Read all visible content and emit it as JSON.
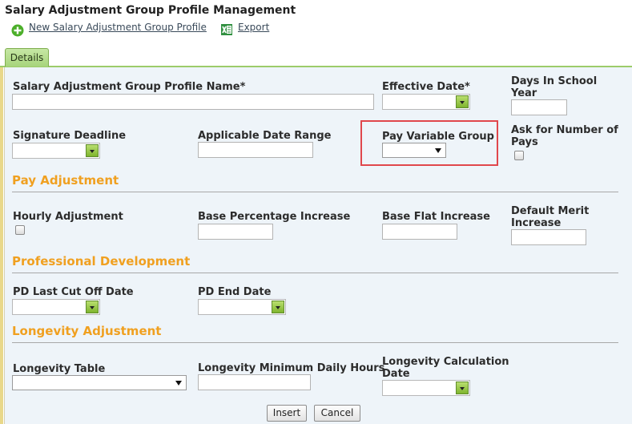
{
  "page": {
    "title": "Salary Adjustment Group Profile Management"
  },
  "toolbar": {
    "new_label": "New Salary Adjustment Group Profile",
    "export_label": "Export",
    "new_icon": "add-circle-icon",
    "export_icon": "excel-icon"
  },
  "tabs": [
    {
      "label": "Details",
      "active": true
    }
  ],
  "fields": {
    "profile_name": {
      "label": "Salary Adjustment Group Profile Name*",
      "value": ""
    },
    "effective_date": {
      "label": "Effective Date*",
      "value": ""
    },
    "days_in_school_year": {
      "label_line1": "Days In School",
      "label_line2": "Year",
      "value": ""
    },
    "signature_deadline": {
      "label": "Signature Deadline",
      "value": ""
    },
    "applicable_date_range": {
      "label": "Applicable Date Range",
      "value": ""
    },
    "pay_variable_group": {
      "label": "Pay Variable Group",
      "selected": ""
    },
    "ask_number_of_pays": {
      "label_line1": "Ask for Number of",
      "label_line2": "Pays",
      "checked": false
    }
  },
  "sections": {
    "pay_adjustment": {
      "title": "Pay Adjustment",
      "hourly_adjustment": {
        "label": "Hourly Adjustment",
        "checked": false
      },
      "base_percentage_increase": {
        "label": "Base Percentage Increase",
        "value": ""
      },
      "base_flat_increase": {
        "label": "Base Flat Increase",
        "value": ""
      },
      "default_merit_increase": {
        "label_line1": "Default Merit",
        "label_line2": "Increase",
        "value": ""
      }
    },
    "professional_development": {
      "title": "Professional Development",
      "pd_last_cut_off_date": {
        "label": "PD Last Cut Off Date",
        "value": ""
      },
      "pd_end_date": {
        "label": "PD End Date",
        "value": ""
      }
    },
    "longevity_adjustment": {
      "title": "Longevity Adjustment",
      "longevity_table": {
        "label": "Longevity Table",
        "selected": ""
      },
      "longevity_min_daily_hours": {
        "label": "Longevity Minimum Daily Hours",
        "value": ""
      },
      "longevity_calc_date": {
        "label_line1": "Longevity Calculation",
        "label_line2": "Date",
        "value": ""
      }
    }
  },
  "buttons": {
    "insert": "Insert",
    "cancel": "Cancel"
  },
  "colors": {
    "section_title": "#f0a020",
    "tab_green": "#a7d47c",
    "panel_bg": "#eef4f9",
    "highlight_border": "#e0474c"
  }
}
